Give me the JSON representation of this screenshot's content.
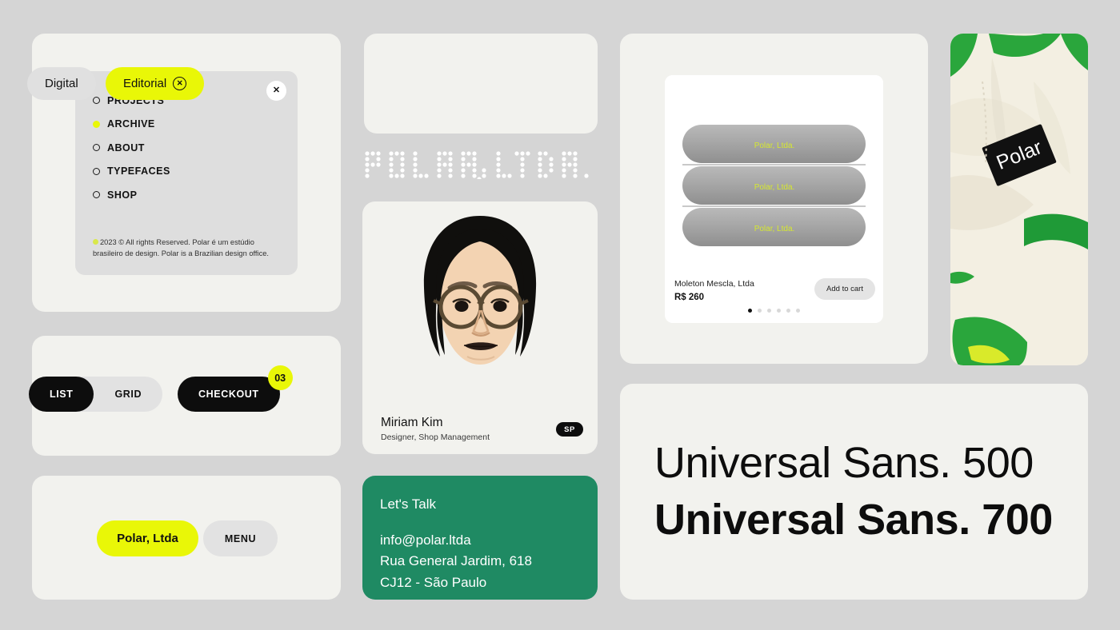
{
  "theme": {
    "page_bg": "#d5d5d5",
    "card_bg": "#f2f2ee",
    "panel_bg": "#dedede",
    "accent_yellow": "#e9f707",
    "black": "#0d0d0d",
    "green": "#1f8a63"
  },
  "nav": {
    "close_label": "✕",
    "items": [
      {
        "label": "PROJECTS",
        "active": false
      },
      {
        "label": "ARCHIVE",
        "active": true
      },
      {
        "label": "ABOUT",
        "active": false
      },
      {
        "label": "TYPEFACES",
        "active": false
      },
      {
        "label": "SHOP",
        "active": false
      }
    ],
    "footer": "2023 © All rights Reserved. Polar é um estúdio brasileiro de design. Polar is a Brazilian design office."
  },
  "view_toggle": {
    "list_label": "LIST",
    "grid_label": "GRID",
    "active": "LIST"
  },
  "checkout": {
    "label": "CHECKOUT",
    "count": "03"
  },
  "brand_pills": {
    "brand_label": "Polar, Ltda",
    "menu_label": "MENU"
  },
  "chips": {
    "digital_label": "Digital",
    "editorial_label": "Editorial",
    "editorial_close": "✕",
    "active": "Editorial"
  },
  "logo": {
    "text": "POLAR, LTDA."
  },
  "profile": {
    "name": "Miriam Kim",
    "role": "Designer, Shop Management",
    "badge": "SP"
  },
  "contact": {
    "title": "Let's Talk",
    "lines": [
      "info@polar.ltda",
      "Rua General Jardim, 618",
      "CJ12 - São Paulo"
    ]
  },
  "product": {
    "name": "Moleton Mescla, Ltda",
    "price": "R$ 260",
    "add_to_cart_label": "Add to cart",
    "garment_text": "Polar, Ltda.",
    "carousel_dots": 6,
    "carousel_active": 0
  },
  "photo": {
    "label_text": "Polar"
  },
  "typography": {
    "weight_500": "Universal Sans. 500",
    "weight_700": "Universal Sans. 700"
  }
}
